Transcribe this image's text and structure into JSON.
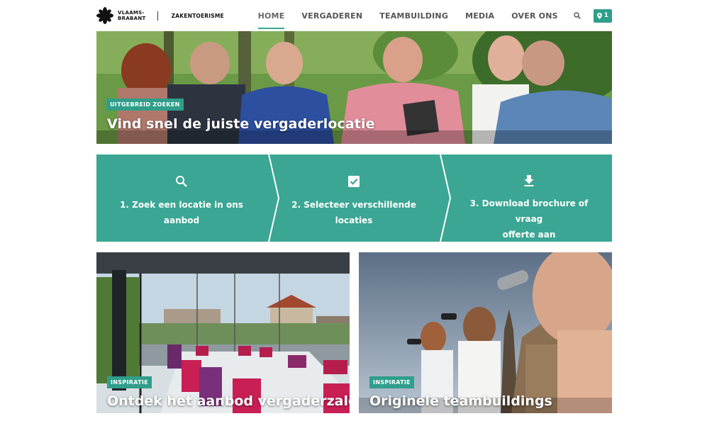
{
  "brand": {
    "name_line1": "VLAAMS-",
    "name_line2": "BRABANT",
    "subtitle": "ZAKENTOERISME",
    "logo_icon": "star-burst-logo-icon"
  },
  "nav": {
    "items": [
      {
        "label": "HOME",
        "active": true
      },
      {
        "label": "VERGADEREN",
        "active": false
      },
      {
        "label": "TEAMBUILDING",
        "active": false
      },
      {
        "label": "MEDIA",
        "active": false
      },
      {
        "label": "OVER ONS",
        "active": false
      }
    ],
    "search_icon": "search-icon",
    "favorites_icon": "map-pin-icon",
    "favorites_count": "1"
  },
  "hero": {
    "tag": "UITGEBREID ZOEKEN",
    "title": "Vind snel de juiste vergaderlocatie"
  },
  "steps": [
    {
      "icon": "search-icon",
      "line1": "1. Zoek een locatie in ons",
      "line2": "aanbod"
    },
    {
      "icon": "checkbox-icon",
      "line1": "2. Selecteer verschillende",
      "line2": "locaties"
    },
    {
      "icon": "download-icon",
      "line1": "3. Download brochure of vraag",
      "line2": "offerte aan"
    }
  ],
  "cards": [
    {
      "tag": "INSPIRATIE",
      "title": "Ontdek het aanbod vergaderzalen"
    },
    {
      "tag": "INSPIRATIE",
      "title": "Originele teambuildings"
    }
  ],
  "colors": {
    "accent": "#2f9e8a",
    "accent_band": "#3aa693",
    "nav_text": "#555555"
  }
}
